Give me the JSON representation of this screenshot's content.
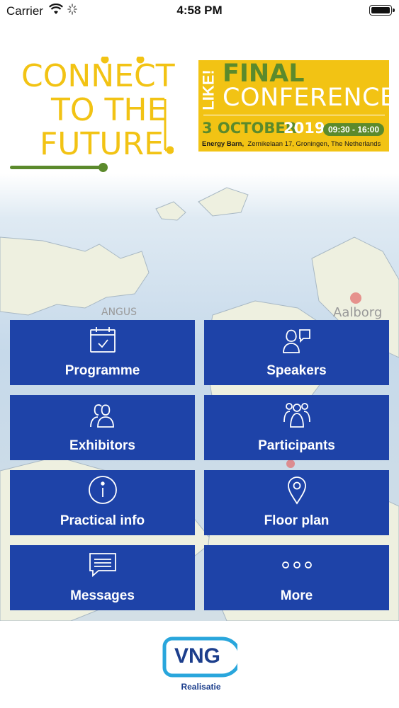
{
  "status_bar": {
    "carrier": "Carrier",
    "time": "4:58 PM"
  },
  "banner": {
    "tagline_line1": "CONNECT",
    "tagline_line2": "TO THE",
    "tagline_line3": "FUTURE",
    "like": "LIKE!",
    "final": "FINAL",
    "conference": "CONFERENCE",
    "date": "3 OCTOBER",
    "year": "2019",
    "time_range": "09:30 - 16:00",
    "venue_name": "Energy Barn,",
    "venue_address": "Zernikelaan 17,  Groningen, The Netherlands",
    "colors": {
      "yellow": "#f2c314",
      "green": "#5b8a2c"
    }
  },
  "menu": [
    {
      "label": "Programme",
      "icon": "calendar-check-icon"
    },
    {
      "label": "Speakers",
      "icon": "speakers-icon"
    },
    {
      "label": "Exhibitors",
      "icon": "exhibitors-icon"
    },
    {
      "label": "Participants",
      "icon": "participants-icon"
    },
    {
      "label": "Practical info",
      "icon": "info-icon"
    },
    {
      "label": "Floor plan",
      "icon": "location-pin-icon"
    },
    {
      "label": "Messages",
      "icon": "message-icon"
    },
    {
      "label": "More",
      "icon": "more-dots-icon"
    }
  ],
  "footer": {
    "logo": "VNG",
    "subtitle": "Realisatie"
  },
  "theme": {
    "tile_color": "#1e43a8",
    "logo_color": "#1c3e8c"
  }
}
